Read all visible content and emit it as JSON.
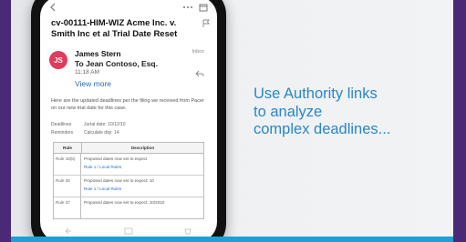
{
  "email": {
    "subject": "cv-00111-HIM-WIZ Acme Inc. v. Smith Inc et al Trial Date Reset",
    "sender_name": "James Stern",
    "sender_initials": "JS",
    "recipient": "To Jean Contoso, Esq.",
    "time": "11:18 AM",
    "view_more": "View more",
    "sent_label": "Inbox",
    "body": "Here are the updated deadlines per the filing we received from Pacer on our new trial date for this case.",
    "meta": [
      {
        "key": "Deadlines",
        "value": "Jurtal date: 10/12/10"
      },
      {
        "key": "Reminders",
        "value": "Calculate day: 14"
      }
    ],
    "table": {
      "headers": [
        "Rule",
        "Description"
      ],
      "rows": [
        {
          "rule": "Rule 16(b)",
          "desc": "Proposed dates now set to expect",
          "link": "Rule 1 / Local Rules"
        },
        {
          "rule": "Rule 26",
          "desc": "Proposed dates now set to expect: 10",
          "link": "Rule 1 / Local Rules"
        },
        {
          "rule": "Rule 37",
          "desc": "Proposed dates now set to expect: 10/2010",
          "link": ""
        }
      ]
    }
  },
  "caption": {
    "line1": "Use Authority links",
    "line2": "to analyze",
    "line3": "complex deadlines..."
  },
  "colors": {
    "caption": "#2a86c6",
    "avatar": "#e03a5c",
    "accent_bar": "#1da0d8",
    "frame": "#4a2a76"
  }
}
